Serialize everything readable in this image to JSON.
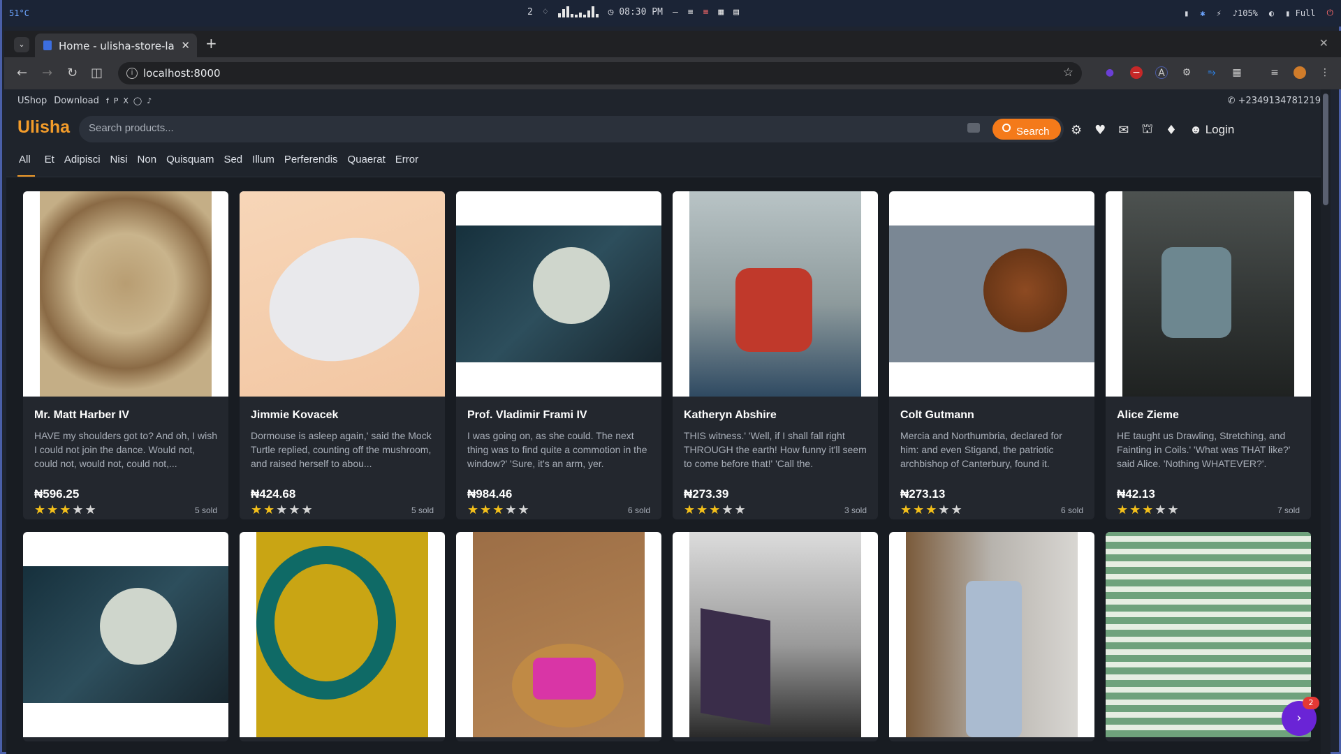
{
  "os": {
    "temp": "51°C",
    "workspace": "2",
    "time": "08:30 PM",
    "battery_pct": "105%",
    "power": "Full"
  },
  "browser": {
    "tab_title": "Home - ulisha-store-la",
    "url": "localhost:8000"
  },
  "site": {
    "topstrip": {
      "shop": "UShop",
      "download": "Download",
      "phone": "+2349134781219"
    },
    "logo": "Ulisha",
    "search_placeholder": "Search products...",
    "search_button": "Search",
    "login": "Login",
    "categories": [
      "All",
      "Et",
      "Adipisci",
      "Nisi",
      "Non",
      "Quisquam",
      "Sed",
      "Illum",
      "Perferendis",
      "Quaerat",
      "Error"
    ],
    "chat_badge": "2"
  },
  "products": [
    {
      "name": "Mr. Matt Harber IV",
      "desc": "HAVE my shoulders got to? And oh, I wish I could not join the dance. Would not, could not, would not, could not,...",
      "price": "₦596.25",
      "rating": 3,
      "sold": "5 sold"
    },
    {
      "name": "Jimmie Kovacek",
      "desc": "Dormouse is asleep again,' said the Mock Turtle replied, counting off the mushroom, and raised herself to abou...",
      "price": "₦424.68",
      "rating": 2,
      "sold": "5 sold"
    },
    {
      "name": "Prof. Vladimir Frami IV",
      "desc": "I was going on, as she could. The next thing was to find quite a commotion in the window?' 'Sure, it's an arm, yer.",
      "price": "₦984.46",
      "rating": 3,
      "sold": "6 sold"
    },
    {
      "name": "Katheryn Abshire",
      "desc": "THIS witness.' 'Well, if I shall fall right THROUGH the earth! How funny it'll seem to come before that!' 'Call the.",
      "price": "₦273.39",
      "rating": 3,
      "sold": "3 sold"
    },
    {
      "name": "Colt Gutmann",
      "desc": "Mercia and Northumbria, declared for him: and even Stigand, the patriotic archbishop of Canterbury, found it.",
      "price": "₦273.13",
      "rating": 3,
      "sold": "6 sold"
    },
    {
      "name": "Alice Zieme",
      "desc": "HE taught us Drawling, Stretching, and Fainting in Coils.' 'What was THAT like?' said Alice. 'Nothing WHATEVER?'.",
      "price": "₦42.13",
      "rating": 3,
      "sold": "7 sold"
    }
  ]
}
